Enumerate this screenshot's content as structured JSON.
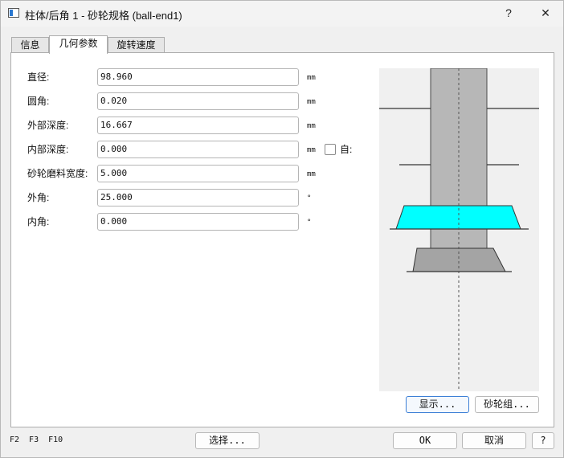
{
  "window": {
    "title": "柱体/后角 1 - 砂轮规格 (ball-end1)",
    "help_glyph": "?",
    "close_glyph": "✕"
  },
  "tabs": [
    {
      "label": "信息",
      "active": false
    },
    {
      "label": "几何参数",
      "active": true
    },
    {
      "label": "旋转速度",
      "active": false
    }
  ],
  "form": {
    "rows": [
      {
        "label": "直径:",
        "value": "98.960",
        "unit": "mm"
      },
      {
        "label": "圆角:",
        "value": "0.020",
        "unit": "mm"
      },
      {
        "label": "外部深度:",
        "value": "16.667",
        "unit": "mm"
      },
      {
        "label": "内部深度:",
        "value": "0.000",
        "unit": "mm"
      },
      {
        "label": "砂轮磨料宽度:",
        "value": "5.000",
        "unit": "mm"
      },
      {
        "label": "外角:",
        "value": "25.000",
        "unit": "°"
      },
      {
        "label": "内角:",
        "value": "0.000",
        "unit": "°"
      }
    ],
    "auto_checkbox_label": "自:",
    "auto_checked": false
  },
  "preview": {
    "buttons": {
      "show": "显示...",
      "wheel_group": "砂轮组..."
    },
    "colors": {
      "wheel": "#00ffff",
      "shank": "#b7b7b7",
      "hub": "#a4a4a4",
      "background": "#f0f0f0"
    }
  },
  "footer": {
    "fkeys": "F2 F3 F10",
    "select": "选择...",
    "ok": "OK",
    "cancel": "取消",
    "help": "?"
  }
}
